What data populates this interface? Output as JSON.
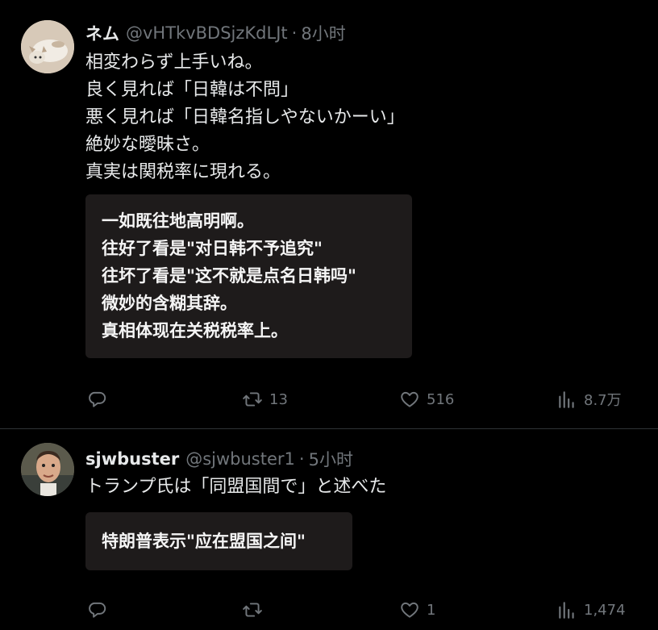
{
  "tweets": [
    {
      "name": "ネム",
      "handle": "@vHTkvBDSjzKdLJt",
      "separator": "·",
      "time": "8小时",
      "body": [
        "相変わらず上手いね。",
        "良く見れば「日韓は不問」",
        "悪く見れば「日韓名指しやないかーい」",
        "絶妙な曖昧さ。",
        "真実は関税率に現れる。"
      ],
      "translation": [
        "一如既往地高明啊。",
        "往好了看是\"对日韩不予追究\"",
        "往坏了看是\"这不就是点名日韩吗\"",
        "微妙的含糊其辞。",
        "真相体现在关税税率上。"
      ],
      "replies": "",
      "retweets": "13",
      "likes": "516",
      "views": "8.7万"
    },
    {
      "name": "sjwbuster",
      "handle": "@sjwbuster1",
      "separator": "·",
      "time": "5小时",
      "body": [
        "トランプ氏は「同盟国間で」と述べた"
      ],
      "translation": [
        "特朗普表示\"应在盟国之间\""
      ],
      "replies": "",
      "retweets": "",
      "likes": "1",
      "views": "1,474"
    }
  ],
  "icons": {
    "reply": "reply-icon",
    "retweet": "retweet-icon",
    "like": "heart-icon",
    "views": "views-icon"
  },
  "colors": {
    "background": "#000000",
    "text": "#e7e9ea",
    "muted": "#71767b",
    "translation_box": "#1e1b1b",
    "divider": "#2f3336"
  }
}
